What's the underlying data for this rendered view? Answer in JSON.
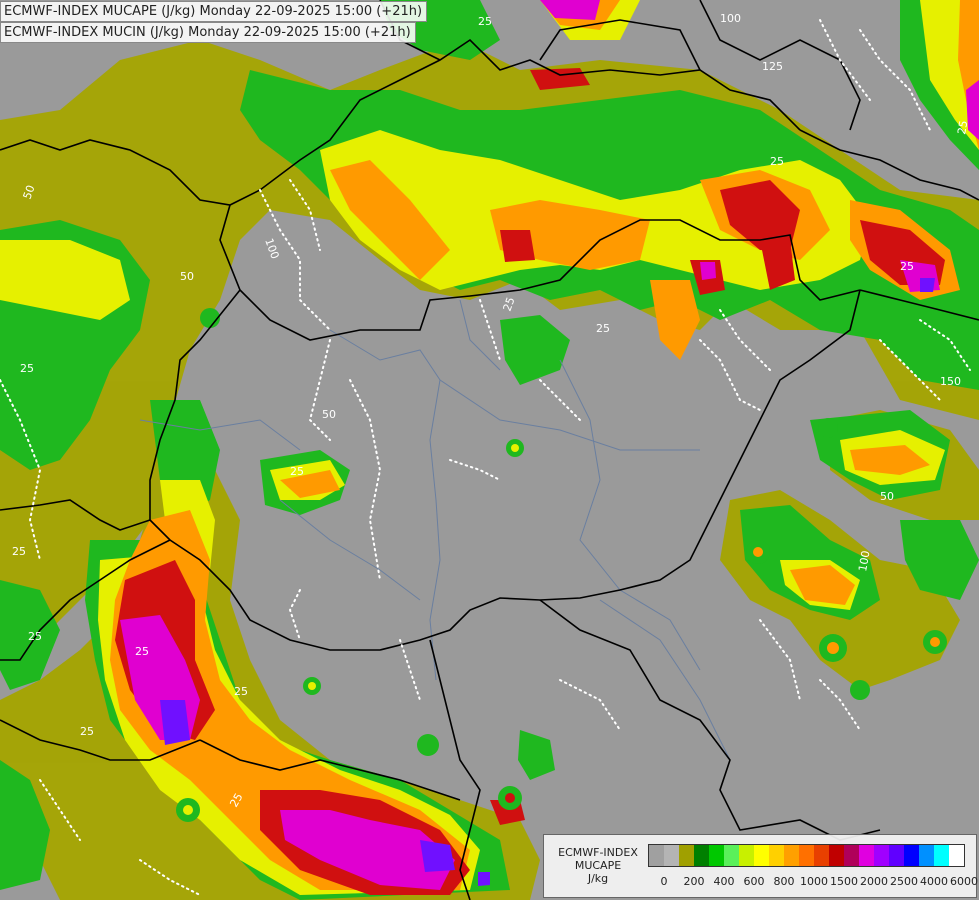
{
  "title": {
    "line1": "ECMWF-INDEX MUCAPE (J/kg) Monday 22-09-2025 15:00 (+21h)",
    "line2": "ECMWF-INDEX MUCIN (J/kg) Monday 22-09-2025 15:00 (+21h)"
  },
  "legend": {
    "line1": "ECMWF-INDEX",
    "line2": "MUCAPE",
    "line3": "J/kg",
    "colors": [
      "#a0a0a0",
      "#b4b4b4",
      "#a0a000",
      "#008000",
      "#00c800",
      "#5af05a",
      "#c8f000",
      "#ffff00",
      "#ffd000",
      "#ffa000",
      "#ff7000",
      "#e84000",
      "#c00000",
      "#b0005a",
      "#e000e0",
      "#a000ff",
      "#6000ff",
      "#0000ff",
      "#0090ff",
      "#00ffff",
      "#ffffff"
    ],
    "ticks": [
      {
        "label": "0",
        "index": 1
      },
      {
        "label": "200",
        "index": 3
      },
      {
        "label": "400",
        "index": 5
      },
      {
        "label": "600",
        "index": 7
      },
      {
        "label": "800",
        "index": 9
      },
      {
        "label": "1000",
        "index": 11
      },
      {
        "label": "1500",
        "index": 13
      },
      {
        "label": "2000",
        "index": 15
      },
      {
        "label": "2500",
        "index": 17
      },
      {
        "label": "4000",
        "index": 19
      },
      {
        "label": "6000",
        "index": 21
      }
    ]
  },
  "contour_labels": [
    "25",
    "50",
    "100",
    "125",
    "150",
    "25",
    "50",
    "25",
    "25",
    "25",
    "25",
    "25",
    "50",
    "25",
    "25",
    "25",
    "25",
    "100",
    "25",
    "25",
    "50",
    "100",
    "25"
  ]
}
